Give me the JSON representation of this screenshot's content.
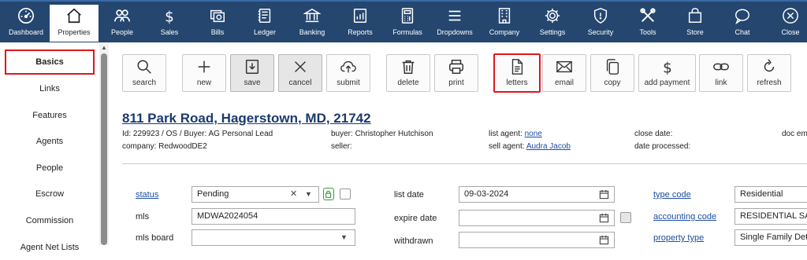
{
  "nav": [
    {
      "label": "Dashboard",
      "icon": "gauge-icon"
    },
    {
      "label": "Properties",
      "icon": "house-icon",
      "active": true
    },
    {
      "label": "People",
      "icon": "people-icon"
    },
    {
      "label": "Sales",
      "icon": "dollar-icon"
    },
    {
      "label": "Bills",
      "icon": "bills-icon"
    },
    {
      "label": "Ledger",
      "icon": "ledger-icon"
    },
    {
      "label": "Banking",
      "icon": "bank-icon"
    },
    {
      "label": "Reports",
      "icon": "reports-icon"
    },
    {
      "label": "Formulas",
      "icon": "calculator-icon"
    },
    {
      "label": "Dropdowns",
      "icon": "menu-icon"
    },
    {
      "label": "Company",
      "icon": "building-icon"
    },
    {
      "label": "Settings",
      "icon": "gear-icon"
    },
    {
      "label": "Security",
      "icon": "shield-icon"
    },
    {
      "label": "Tools",
      "icon": "tools-icon"
    },
    {
      "label": "Store",
      "icon": "bag-icon"
    },
    {
      "label": "Chat",
      "icon": "chat-icon"
    },
    {
      "label": "Close",
      "icon": "close-icon"
    }
  ],
  "sidebar": {
    "items": [
      {
        "label": "Basics",
        "active": true
      },
      {
        "label": "Links"
      },
      {
        "label": "Features"
      },
      {
        "label": "Agents"
      },
      {
        "label": "People"
      },
      {
        "label": "Escrow"
      },
      {
        "label": "Commission"
      },
      {
        "label": "Agent Net Lists"
      }
    ]
  },
  "toolbar": {
    "search": "search",
    "new": "new",
    "save": "save",
    "cancel": "cancel",
    "submit": "submit",
    "delete": "delete",
    "print": "print",
    "letters": "letters",
    "email": "email",
    "copy": "copy",
    "add_payment": "add payment",
    "link": "link",
    "refresh": "refresh"
  },
  "record": {
    "address": "811 Park Road, Hagerstown, MD, 21742",
    "id_line": "Id: 229923 / OS / Buyer: AG Personal Lead",
    "company": "company: RedwoodDE2",
    "buyer_label": "buyer:",
    "buyer": "Christopher Hutchison",
    "seller_label": "seller:",
    "list_agent_label": "list agent:",
    "list_agent": "none",
    "sell_agent_label": "sell agent:",
    "sell_agent": "Audra Jacob",
    "close_date_label": "close date:",
    "date_processed_label": "date processed:",
    "doc_em_label": "doc em"
  },
  "form": {
    "status_label": "status",
    "status_value": "Pending",
    "mls_label": "mls",
    "mls_value": "MDWA2024054",
    "mls_board_label": "mls board",
    "mls_board_value": "",
    "list_date_label": "list date",
    "list_date_value": "09-03-2024",
    "expire_date_label": "expire date",
    "expire_date_value": "",
    "withdrawn_label": "withdrawn",
    "withdrawn_value": "",
    "type_code_label": "type code",
    "type_code_value": "Residential",
    "accounting_code_label": "accounting code",
    "accounting_code_value": "RESIDENTIAL SALE",
    "property_type_label": "property type",
    "property_type_value": "Single Family Detached"
  },
  "colors": {
    "nav_bg": "#24466f",
    "highlight": "#e0161d",
    "link": "#1c4ea0"
  }
}
